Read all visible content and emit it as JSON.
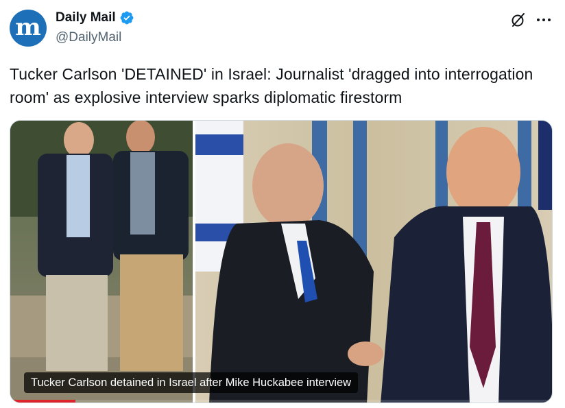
{
  "account": {
    "display_name": "Daily Mail",
    "handle": "@DailyMail",
    "verified": true,
    "avatar_letter": "m",
    "avatar_color": "#1d6fb8"
  },
  "header_icons": [
    "grok-icon",
    "more-icon"
  ],
  "tweet": {
    "text": "Tucker Carlson 'DETAINED' in Israel: Journalist 'dragged into interrogation room' as explosive interview sparks diplomatic firestorm"
  },
  "media": {
    "caption": "Tucker Carlson detained in Israel after Mike Huckabee interview",
    "progress_fraction": 0.12,
    "progress_color": "#e0242a"
  }
}
